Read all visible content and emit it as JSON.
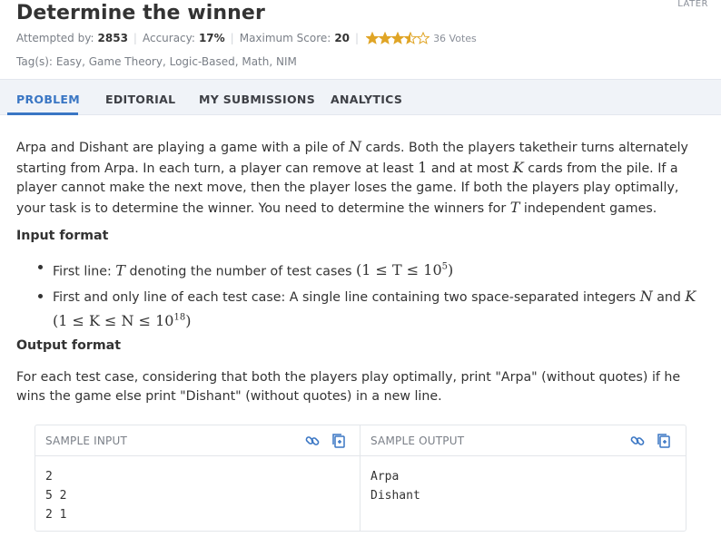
{
  "problem": {
    "title": "Determine the winner",
    "later_label": "LATER"
  },
  "meta": {
    "attempted_label": "Attempted by:",
    "attempted_value": "2853",
    "accuracy_label": "Accuracy:",
    "accuracy_value": "17%",
    "max_score_label": "Maximum Score:",
    "max_score_value": "20",
    "rating": 3.5,
    "rating_max": 5,
    "votes": "36 Votes",
    "star_color": "#e0a526"
  },
  "tags": {
    "label": "Tag(s):",
    "items": [
      "Easy",
      "Game Theory",
      "Logic-Based",
      "Math",
      "NIM"
    ]
  },
  "tabs": [
    {
      "label": "PROBLEM",
      "active": true
    },
    {
      "label": "EDITORIAL",
      "active": false
    },
    {
      "label": "MY SUBMISSIONS",
      "active": false
    },
    {
      "label": "ANALYTICS",
      "active": false
    }
  ],
  "statement": {
    "p1": "Arpa and Dishant are playing a game with a pile of",
    "N": "N",
    "p2": "cards. Both the players taketheir turns alternately starting from Arpa. In each turn, a player can remove at least",
    "one": "1",
    "p3": "and at most",
    "K": "K",
    "p4": "cards from the pile. If a player cannot make the next move, then the player loses the game. If both the players play optimally, your task is to determine the winner. You need to determine the winners for",
    "T": "T",
    "p5": "independent games."
  },
  "input_format": {
    "heading": "Input format",
    "b1_text": "First line:",
    "b1_var": "T",
    "b1_rest": "denoting the number of test cases",
    "b1_constraint": "(1 ≤ T ≤ 10",
    "b1_exp": "5",
    "b1_close": ")",
    "b2_text": "First and only line of each test case: A single line containing two space-separated integers",
    "b2_n": "N",
    "b2_and": "and",
    "b2_k": "K",
    "b2_constraint": "(1 ≤ K ≤ N ≤ 10",
    "b2_exp": "18",
    "b2_close": ")"
  },
  "output_format": {
    "heading": "Output format",
    "text": "For each test case, considering that both the players play optimally, print \"Arpa\" (without quotes) if he wins the game else print \"Dishant\" (without quotes) in a new line."
  },
  "sample": {
    "input_label": "SAMPLE INPUT",
    "output_label": "SAMPLE OUTPUT",
    "input_lines": [
      "2",
      "5 2",
      "2 1"
    ],
    "output_lines": [
      "Arpa",
      "Dishant"
    ],
    "icon_color": "#3a76c4"
  }
}
